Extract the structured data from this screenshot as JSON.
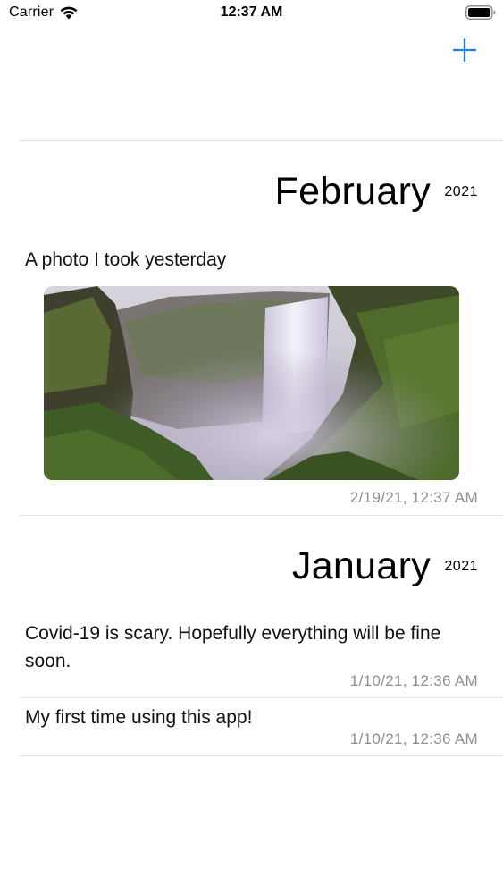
{
  "status_bar": {
    "carrier": "Carrier",
    "time": "12:37 AM"
  },
  "nav": {
    "add_icon": "plus-icon",
    "accent_color": "#1a7cf0"
  },
  "sections": [
    {
      "month": "February",
      "year": "2021",
      "entries": [
        {
          "text": "A photo I took yesterday",
          "has_photo": true,
          "photo_subject": "waterfall",
          "timestamp": "2/19/21, 12:37 AM"
        }
      ]
    },
    {
      "month": "January",
      "year": "2021",
      "entries": [
        {
          "text": "Covid-19 is scary. Hopefully everything will be fine soon.",
          "timestamp": "1/10/21, 12:36 AM"
        },
        {
          "text": "My first time using this app!",
          "timestamp": "1/10/21, 12:36 AM"
        }
      ]
    }
  ]
}
